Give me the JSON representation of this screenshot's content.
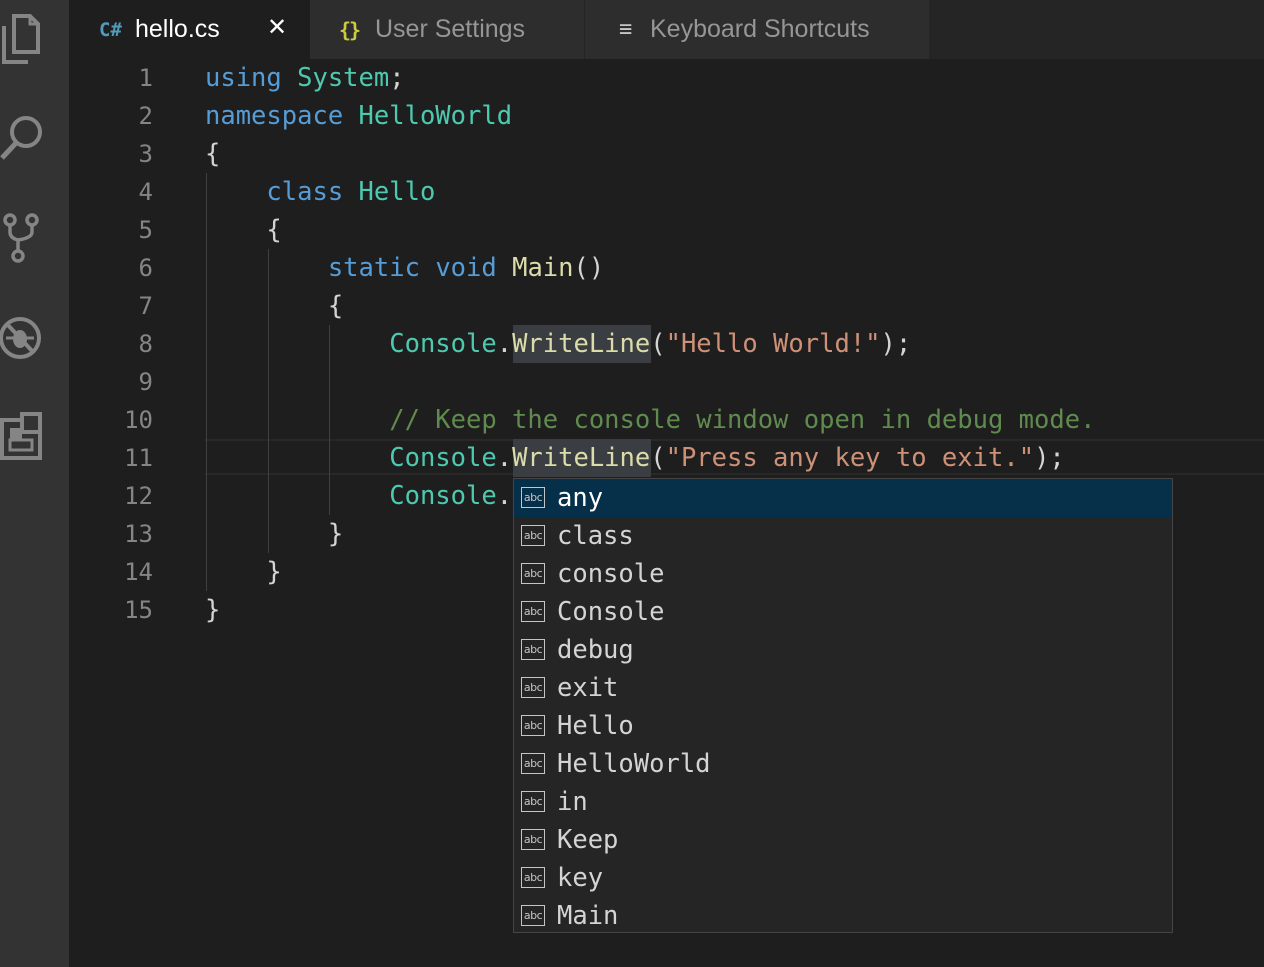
{
  "tabs": [
    {
      "icon": "C#",
      "label": "hello.cs",
      "active": true,
      "close": "✕"
    },
    {
      "icon": "{}",
      "label": "User Settings",
      "active": false
    },
    {
      "icon": "≡",
      "label": "Keyboard Shortcuts",
      "active": false
    }
  ],
  "activity_bar": [
    "explorer-icon",
    "search-icon",
    "source-control-icon",
    "debug-icon",
    "extensions-icon"
  ],
  "code": [
    {
      "n": "1",
      "tokens": [
        [
          "kw",
          "using"
        ],
        [
          "pn",
          " "
        ],
        [
          "ty",
          "System"
        ],
        [
          "pn",
          ";"
        ]
      ]
    },
    {
      "n": "2",
      "tokens": [
        [
          "kw",
          "namespace"
        ],
        [
          "pn",
          " "
        ],
        [
          "ty",
          "HelloWorld"
        ]
      ]
    },
    {
      "n": "3",
      "tokens": [
        [
          "pn",
          "{"
        ]
      ]
    },
    {
      "n": "4",
      "tokens": [
        [
          "pn",
          "    "
        ],
        [
          "kw",
          "class"
        ],
        [
          "pn",
          " "
        ],
        [
          "ty",
          "Hello"
        ]
      ]
    },
    {
      "n": "5",
      "tokens": [
        [
          "pn",
          "    {"
        ]
      ]
    },
    {
      "n": "6",
      "tokens": [
        [
          "pn",
          "        "
        ],
        [
          "kw",
          "static"
        ],
        [
          "pn",
          " "
        ],
        [
          "kw",
          "void"
        ],
        [
          "pn",
          " "
        ],
        [
          "fn",
          "Main"
        ],
        [
          "pn",
          "()"
        ]
      ]
    },
    {
      "n": "7",
      "tokens": [
        [
          "pn",
          "        {"
        ]
      ]
    },
    {
      "n": "8",
      "tokens": [
        [
          "pn",
          "            "
        ],
        [
          "ty",
          "Console"
        ],
        [
          "pn",
          "."
        ],
        [
          "fn",
          "WriteLine"
        ],
        [
          "pn",
          "("
        ],
        [
          "st",
          "\"Hello World!\""
        ],
        [
          "pn",
          ");"
        ]
      ]
    },
    {
      "n": "9",
      "tokens": []
    },
    {
      "n": "10",
      "tokens": [
        [
          "pn",
          "            "
        ],
        [
          "cm",
          "// Keep the console window open in debug mode."
        ]
      ]
    },
    {
      "n": "11",
      "tokens": [
        [
          "pn",
          "            "
        ],
        [
          "ty",
          "Console"
        ],
        [
          "pn",
          "."
        ],
        [
          "fn",
          "WriteLine"
        ],
        [
          "pn",
          "("
        ],
        [
          "st",
          "\"Press any key to exit.\""
        ],
        [
          "pn",
          ");"
        ]
      ]
    },
    {
      "n": "12",
      "tokens": [
        [
          "pn",
          "            "
        ],
        [
          "ty",
          "Console"
        ],
        [
          "pn",
          "."
        ]
      ]
    },
    {
      "n": "13",
      "tokens": [
        [
          "pn",
          "        }"
        ]
      ]
    },
    {
      "n": "14",
      "tokens": [
        [
          "pn",
          "    }"
        ]
      ]
    },
    {
      "n": "15",
      "tokens": [
        [
          "pn",
          "}"
        ]
      ]
    }
  ],
  "suggestions": {
    "icon_text": "abc",
    "selected_index": 0,
    "items": [
      "any",
      "class",
      "console",
      "Console",
      "debug",
      "exit",
      "Hello",
      "HelloWorld",
      "in",
      "Keep",
      "key",
      "Main"
    ]
  },
  "colors": {
    "keyword": "#569cd6",
    "type": "#4ec9b0",
    "function": "#dcdcaa",
    "string": "#ce9178",
    "comment": "#608b4e",
    "csharp_icon": "#519aba",
    "json_icon": "#cbcb41"
  }
}
